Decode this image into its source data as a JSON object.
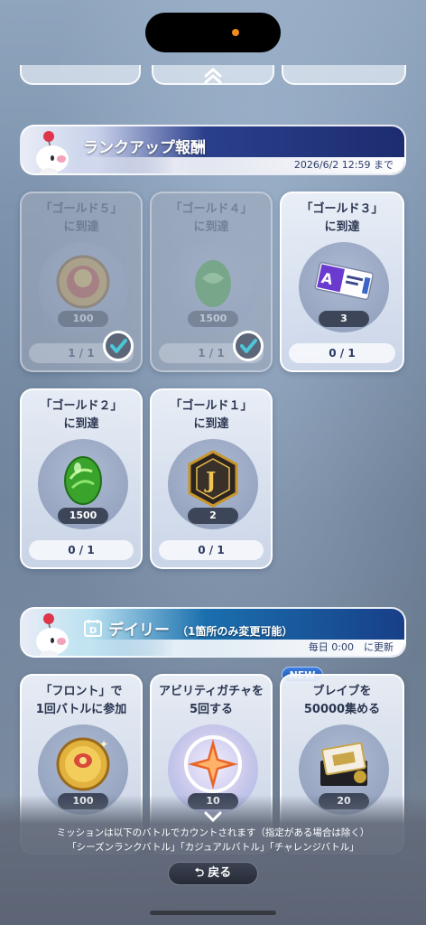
{
  "rank_section": {
    "title": "ランクアップ報酬",
    "deadline": "2026/6/2 12:59 まで"
  },
  "rank_cards": [
    {
      "title_line1": "「ゴールド５」",
      "title_line2": "に到達",
      "item_icon": "coin-icon",
      "quantity": "100",
      "progress": "1 / 1",
      "claimed": true
    },
    {
      "title_line1": "「ゴールド４」",
      "title_line2": "に到達",
      "item_icon": "green-egg-icon",
      "quantity": "1500",
      "progress": "1 / 1",
      "claimed": true
    },
    {
      "title_line1": "「ゴールド３」",
      "title_line2": "に到達",
      "item_icon": "ability-ticket-icon",
      "quantity": "3",
      "progress": "0 / 1",
      "claimed": false
    },
    {
      "title_line1": "「ゴールド２」",
      "title_line2": "に到達",
      "item_icon": "green-egg-icon",
      "quantity": "1500",
      "progress": "0 / 1",
      "claimed": false
    },
    {
      "title_line1": "「ゴールド１」",
      "title_line2": "に到達",
      "item_icon": "j-emblem-icon",
      "quantity": "2",
      "progress": "0 / 1",
      "claimed": false
    }
  ],
  "daily_section": {
    "title": "デイリー",
    "note": "（1箇所のみ変更可能）",
    "refresh": "毎日 0:00　に更新"
  },
  "daily_cards": [
    {
      "title_line1": "「フロント」で",
      "title_line2": "1回バトルに参加",
      "item_icon": "coin-icon",
      "quantity": "100"
    },
    {
      "title_line1": "アビリティガチャを",
      "title_line2": "5回する",
      "item_icon": "star-crystal-icon",
      "quantity": "10"
    },
    {
      "title_line1": "ブレイブを",
      "title_line2": "50000集める",
      "item_icon": "ticket-envelope-icon",
      "quantity": "20",
      "badge": "NEW"
    }
  ],
  "footer": {
    "line1": "ミッションは以下のバトルでカウントされます（指定がある場合は除く）",
    "line2": "「シーズンランクバトル」「カジュアルバトル」「チャレンジバトル」",
    "back_label": "戻る"
  },
  "colors": {
    "accent_navy": "#1d2c70",
    "daily_blue": "#1a6fae",
    "check_teal": "#4ac7d8",
    "new_blue": "#1b4fa8"
  }
}
